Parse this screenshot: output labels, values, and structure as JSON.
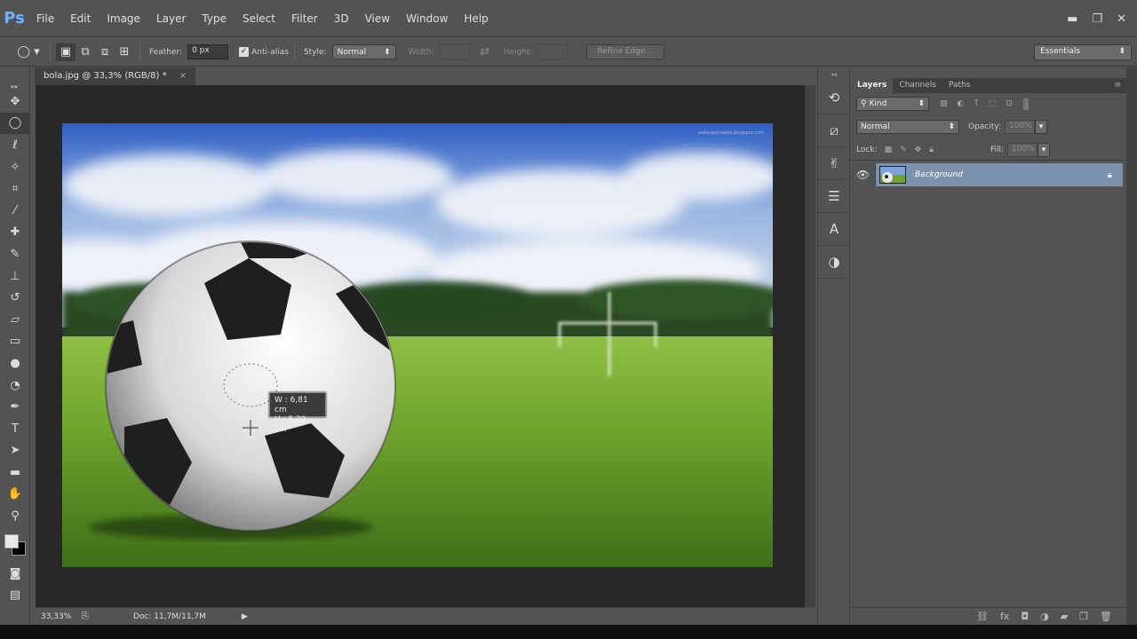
{
  "app": {
    "logo": "Ps"
  },
  "menu": [
    "File",
    "Edit",
    "Image",
    "Layer",
    "Type",
    "Select",
    "Filter",
    "3D",
    "View",
    "Window",
    "Help"
  ],
  "window_controls": {
    "minimize": "▬",
    "restore": "❐",
    "close": "✕"
  },
  "options": {
    "feather_label": "Feather:",
    "feather_value": "0 px",
    "antialias_label": "Anti-alias",
    "antialias_checked": true,
    "style_label": "Style:",
    "style_value": "Normal",
    "width_label": "Width:",
    "height_label": "Height:",
    "refine_label": "Refine Edge...",
    "workspace": "Essentials"
  },
  "document": {
    "tab_title": "bola.jpg @ 33,3% (RGB/8) *",
    "tab_close": "×",
    "zoom": "33,33%",
    "doc_info": "Doc: 11,7M/11,7M",
    "tooltip_w": "W :   6,81 cm",
    "tooltip_h": "H :   5,29 cm",
    "watermark": "wallpaperswide.blogspot.com"
  },
  "layers_panel": {
    "tabs": [
      "Layers",
      "Channels",
      "Paths"
    ],
    "filter_kind": "Kind",
    "blend_mode": "Normal",
    "opacity_label": "Opacity:",
    "opacity_value": "100%",
    "lock_label": "Lock:",
    "fill_label": "Fill:",
    "fill_value": "100%",
    "layer_name": "Background"
  },
  "colors": {
    "accent": "#6fb1ff",
    "selected_layer": "#7b93ad"
  }
}
